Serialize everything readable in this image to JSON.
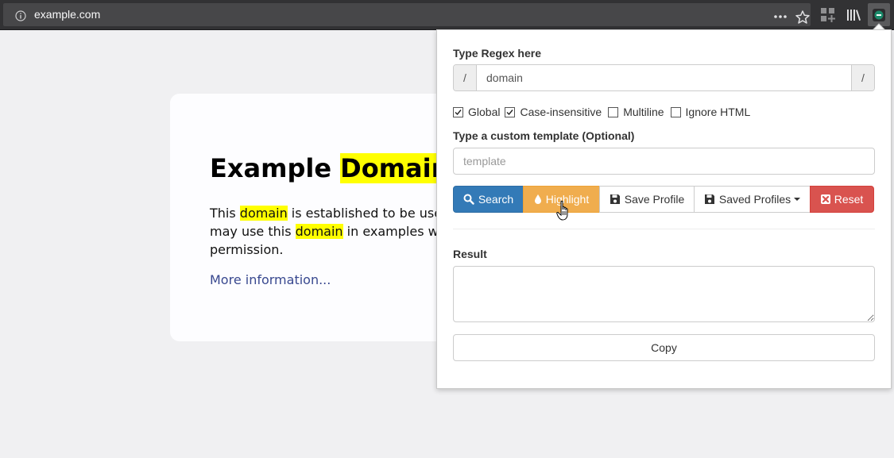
{
  "browser": {
    "url": "example.com"
  },
  "page": {
    "title_plain": "Example ",
    "title_highlight": "Domain",
    "p1_a": "This ",
    "p1_hl1": "domain",
    "p1_b": " is established to be used fo",
    "p1_c": "may use this ",
    "p1_hl2": "domain",
    "p1_d": " in examples withou",
    "p1_e": "permission.",
    "more_link": "More information..."
  },
  "popup": {
    "regex_label": "Type Regex here",
    "regex_prefix": "/",
    "regex_value": "domain",
    "regex_suffix": "/",
    "flags": [
      {
        "label": "Global",
        "checked": true
      },
      {
        "label": "Case-insensitive",
        "checked": true
      },
      {
        "label": "Multiline",
        "checked": false
      },
      {
        "label": "Ignore HTML",
        "checked": false
      }
    ],
    "template_label": "Type a custom template (Optional)",
    "template_placeholder": "template",
    "buttons": {
      "search": "Search",
      "highlight": "Highlight",
      "save_profile": "Save Profile",
      "saved_profiles": "Saved Profiles",
      "reset": "Reset"
    },
    "result_label": "Result",
    "result_value": "",
    "copy": "Copy"
  },
  "colors": {
    "search": "#337ab7",
    "highlight": "#f0ad4e",
    "reset": "#d9534f",
    "text_highlight": "#ffff00"
  },
  "icons": [
    "info-icon",
    "more-dots-icon",
    "bookmark-star-icon",
    "container-icon",
    "library-icon",
    "extension-icon",
    "search-icon",
    "drop-icon",
    "save-icon",
    "profiles-icon",
    "close-icon",
    "hand-cursor-icon"
  ]
}
